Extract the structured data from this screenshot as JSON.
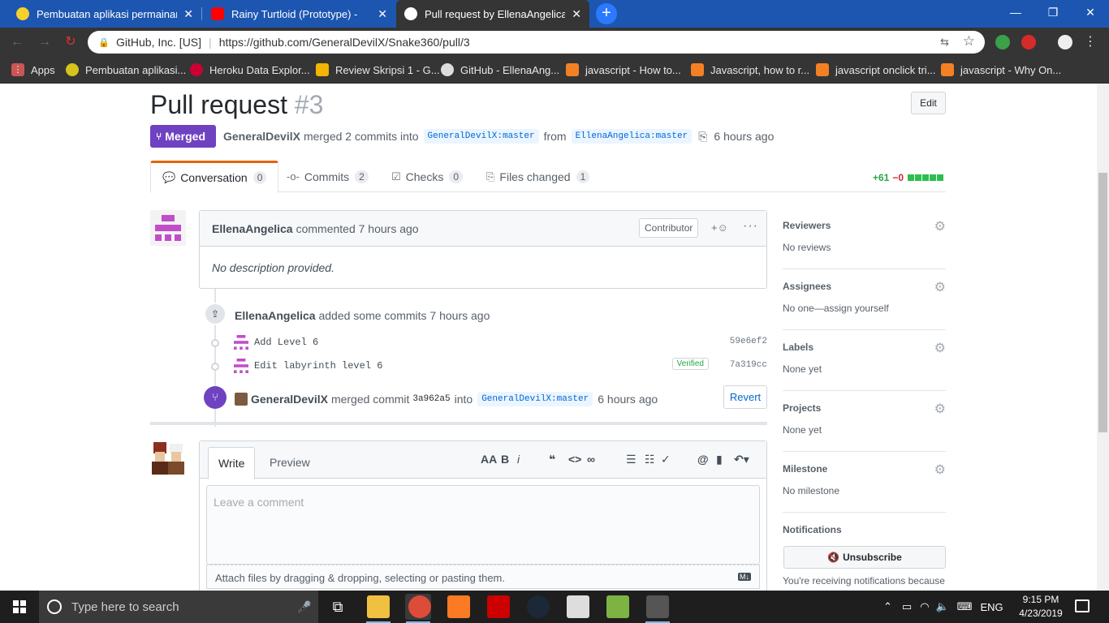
{
  "browser": {
    "tabs": [
      {
        "title": "Pembuatan aplikasi permainan p",
        "close": "✕"
      },
      {
        "title": "Rainy Turtloid (Prototype) - ",
        "close": "✕"
      },
      {
        "title": "Pull request by EllenaAngelica · P",
        "close": "✕"
      }
    ],
    "new_tab": "+",
    "site_identity": "GitHub, Inc. [US]",
    "url": "https://github.com/GeneralDevilX/Snake360/pull/3",
    "bookmarks": [
      {
        "label": "Apps"
      },
      {
        "label": "Pembuatan aplikasi..."
      },
      {
        "label": "Heroku Data Explor..."
      },
      {
        "label": "Review Skripsi 1 - G..."
      },
      {
        "label": "GitHub - EllenaAng..."
      },
      {
        "label": "javascript - How to..."
      },
      {
        "label": "Javascript, how to r..."
      },
      {
        "label": "javascript onclick tri..."
      },
      {
        "label": "javascript - Why On..."
      }
    ]
  },
  "pr": {
    "title": "Pull request",
    "number": "#3",
    "edit_label": "Edit",
    "state_label": "Merged",
    "merger": "GeneralDevilX",
    "merged_text": "merged 2 commits into",
    "base_branch": "GeneralDevilX:master",
    "from_text": "from",
    "head_branch": "EllenaAngelica:master",
    "time": "6 hours ago",
    "tabs": [
      {
        "label": "Conversation",
        "count": "0"
      },
      {
        "label": "Commits",
        "count": "2"
      },
      {
        "label": "Checks",
        "count": "0"
      },
      {
        "label": "Files changed",
        "count": "1"
      }
    ],
    "additions": "+61",
    "deletions": "−0"
  },
  "comment": {
    "author": "EllenaAngelica",
    "action": "commented 7 hours ago",
    "role_badge": "Contributor",
    "reaction": "+☺",
    "more": "···",
    "body": "No description provided."
  },
  "timeline": {
    "commits_event_author": "EllenaAngelica",
    "commits_event_text": "added some commits 7 hours ago",
    "commits": [
      {
        "message": "Add Level 6",
        "sha": "59e6ef2",
        "verified": ""
      },
      {
        "message": "Edit labyrinth level 6",
        "sha": "7a319cc",
        "verified": "Verified"
      }
    ],
    "merge_author": "GeneralDevilX",
    "merge_text": "merged commit",
    "merge_sha": "3a962a5",
    "merge_into": "into",
    "merge_branch": "GeneralDevilX:master",
    "merge_time": "6 hours ago",
    "revert_label": "Revert"
  },
  "new_comment": {
    "write_tab": "Write",
    "preview_tab": "Preview",
    "placeholder": "Leave a comment",
    "attach_text": "Attach files by dragging & dropping, selecting or pasting them.",
    "md_badge": "M↓"
  },
  "sidebar": {
    "reviewers": {
      "heading": "Reviewers",
      "value": "No reviews"
    },
    "assignees": {
      "heading": "Assignees",
      "value": "No one—assign yourself"
    },
    "labels": {
      "heading": "Labels",
      "value": "None yet"
    },
    "projects": {
      "heading": "Projects",
      "value": "None yet"
    },
    "milestone": {
      "heading": "Milestone",
      "value": "No milestone"
    },
    "notifications": {
      "heading": "Notifications",
      "button": "Unsubscribe",
      "text": "You're receiving notifications because"
    }
  },
  "taskbar": {
    "search_placeholder": "Type here to search",
    "language": "ENG",
    "time": "9:15 PM",
    "date": "4/23/2019"
  },
  "colors": {
    "merged": "#6f42c1",
    "link": "#0366d6",
    "added": "#28a745",
    "deleted": "#cb2431",
    "tab_strip": "#1d56b1"
  }
}
